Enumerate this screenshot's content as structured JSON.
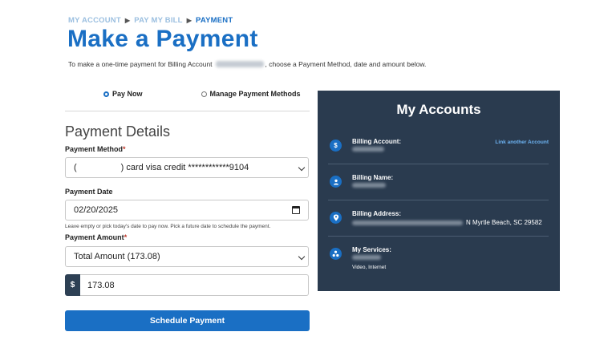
{
  "breadcrumb": {
    "items": [
      "MY ACCOUNT",
      "PAY MY BILL"
    ],
    "current": "PAYMENT"
  },
  "page_title": "Make a Payment",
  "intro": {
    "before": "To make a one-time payment for Billing Account",
    "after": ", choose a Payment Method, date and amount below."
  },
  "radio": {
    "pay_now": "Pay Now",
    "manage": "Manage Payment Methods",
    "selected": "pay_now"
  },
  "payment_details": {
    "title": "Payment Details",
    "method_label": "Payment Method",
    "method_open_paren": "(",
    "method_value": ") card visa credit ************9104",
    "date_label": "Payment Date",
    "date_value": "02/20/2025",
    "date_hint": "Leave empty or pick today's date to pay now. Pick a future date to schedule the payment.",
    "amount_label": "Payment Amount",
    "amount_select": "Total Amount (173.08)",
    "currency_symbol": "$",
    "amount_value": "173.08",
    "required_mark": "*",
    "submit": "Schedule Payment"
  },
  "accounts": {
    "title": "My Accounts",
    "link_another": "Link another Account",
    "billing_account_label": "Billing Account:",
    "billing_name_label": "Billing Name:",
    "billing_address_label": "Billing Address:",
    "billing_address_visible": "N Myrtle Beach, SC 29582",
    "services_label": "My Services:",
    "services_value": "Video, Internet"
  },
  "colors": {
    "brand_blue": "#1a6fc4",
    "panel_navy": "#2a3b4f",
    "link_light_blue": "#6db3f2"
  },
  "icons": {
    "billing_account": "dollar-icon",
    "billing_name": "person-icon",
    "billing_address": "location-pin-icon",
    "services": "services-icon"
  }
}
